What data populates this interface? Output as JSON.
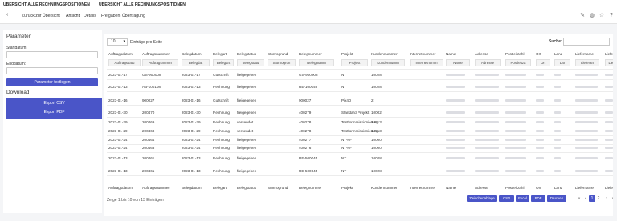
{
  "header": {
    "title_left": "ÜBERSICHT ALLE RECHNUNGSPOSITIONEN",
    "title_right": "ÜBERSICHT ALLE RECHNUNGSPOSITIONEN"
  },
  "nav": {
    "back_icon": "chevron-left-icon",
    "tabs": [
      "Zurück zur Übersicht",
      "Ansicht",
      "Details",
      "Freigaben",
      "Übertragung"
    ],
    "active_tab": "Ansicht",
    "tools": [
      "pencil-icon",
      "globe-icon",
      "star-icon",
      "help-icon"
    ]
  },
  "params": {
    "heading": "Parameter",
    "start_label": "Startdatum:",
    "start_value": "",
    "end_label": "Enddatum:",
    "end_value": "",
    "apply_button": "Parameter festlegen",
    "download_heading": "Download",
    "export_csv": "Export CSV",
    "export_pdf": "Export PDF"
  },
  "table": {
    "page_length": "10",
    "page_length_label": "Einträge pro Seite",
    "search_label": "Suche:",
    "search_value": "",
    "columns": [
      "Auftragsdatum",
      "Auftragsnummer",
      "Belegdatum",
      "Belegart",
      "Belegstatus",
      "Stornogrund",
      "Belegnummer",
      "Projekt",
      "Kundennummer",
      "Internetnummer",
      "Name",
      "Adresse",
      "Postleitzahl",
      "Ort",
      "Land",
      "Liefername",
      "Lieferad"
    ],
    "filters": [
      "Auftragsdatu",
      "Auftragsnumm",
      "Belegdat",
      "Belegart",
      "Belegstatu",
      "Stornogrun",
      "Belegnumm",
      "Projekt",
      "Kundennumm",
      "Internetnumm",
      "Name",
      "Adresse",
      "Postleitza",
      "Ort",
      "Lar",
      "Lieferan",
      "Liefer"
    ],
    "footer_columns": [
      "Auftragsdatum",
      "Auftragsnummer",
      "Belegdatum",
      "Belegart",
      "Belegstatus",
      "Stornogrund",
      "Belegnummer",
      "Projekt",
      "Kundennummer",
      "Internetnummer",
      "Name",
      "Adresse",
      "Postleitzahl",
      "Ort",
      "Land",
      "Liefername",
      "Lieferad"
    ],
    "rows": [
      [
        "2023-01-17",
        "GS-900008",
        "2023-01-17",
        "Gutschrift",
        "freigegeben",
        "",
        "GS-900008",
        "NT",
        "10028"
      ],
      [
        "2023-01-13",
        "AB-100108",
        "2023-01-13",
        "Rechnung",
        "freigegeben",
        "",
        "RE-100046",
        "NT",
        "10028"
      ],
      [
        "2023-01-16",
        "900027",
        "2023-01-16",
        "Gutschrift",
        "freigegeben",
        "",
        "900027",
        "Pix4D",
        "2"
      ],
      [
        "2023-01-30",
        "200470",
        "2023-01-30",
        "Rechnung",
        "freigegeben",
        "",
        "400279",
        "Standard Projekt",
        "10002"
      ],
      [
        "2023-01-29",
        "200469",
        "2023-01-29",
        "Rechnung",
        "versendet",
        "",
        "400278",
        "Testformmissionierung",
        "10013"
      ],
      [
        "2023-01-29",
        "200468",
        "2023-01-29",
        "Rechnung",
        "versendet",
        "",
        "400278",
        "Testformmissionierung",
        "10013"
      ],
      [
        "2023-01-24",
        "200464",
        "2023-01-24",
        "Rechnung",
        "freigegeben",
        "",
        "400277",
        "NT-FF",
        "10000"
      ],
      [
        "2023-01-24",
        "200463",
        "2023-01-24",
        "Rechnung",
        "freigegeben",
        "",
        "400276",
        "NT-FF",
        "10000"
      ],
      [
        "2023-01-13",
        "200461",
        "2023-01-13",
        "Rechnung",
        "freigegeben",
        "",
        "RE-500045",
        "NT",
        "10028"
      ],
      [
        "2023-01-13",
        "200461",
        "2023-01-13",
        "Rechnung",
        "freigegeben",
        "",
        "RE-500045",
        "NT",
        "10028"
      ]
    ],
    "info": "Zeige 1 bis 10 von 13 Einträgen",
    "buttons": [
      "Zwischenablage",
      "CSV",
      "Excel",
      "PDF",
      "Drucken"
    ],
    "pagination": [
      "«",
      "‹",
      "1",
      "2",
      "›",
      "»"
    ],
    "current_page": "1"
  },
  "colors": {
    "accent": "#4a55c8",
    "filter_bg": "#f3f3f3",
    "redacted": "#dcdde2"
  }
}
